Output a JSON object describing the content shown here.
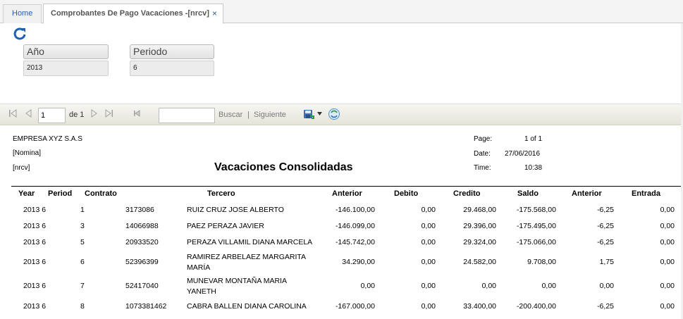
{
  "tabs": {
    "home": "Home",
    "active": "Comprobantes De Pago Vacaciones -[nrcv]",
    "close": "×"
  },
  "params": {
    "anio_label": "Año",
    "anio_value": "2013",
    "periodo_label": "Periodo",
    "periodo_value": "6"
  },
  "toolbar": {
    "page_value": "1",
    "of_text": "de 1",
    "search_placeholder": "",
    "buscar": "Buscar",
    "separator": "|",
    "siguiente": "Siguiente"
  },
  "report": {
    "company": "EMPRESA XYZ S.A.S",
    "line2": "[Nomina]",
    "line3": "[nrcv]",
    "title": "Vacaciones Consolidadas",
    "page_label": "Page:",
    "page_value": "1 of 1",
    "date_label": "Date:",
    "date_value": "27/06/2016",
    "time_label": "Time:",
    "time_value": "10:38"
  },
  "columns": {
    "year": "Year",
    "period": "Period",
    "contrato": "Contrato",
    "tercero": "Tercero",
    "anterior": "Anterior",
    "debito": "Debito",
    "credito": "Credito",
    "saldo": "Saldo",
    "anterior2": "Anterior",
    "entrada": "Entrada"
  },
  "rows": [
    {
      "year_period": "2013 6",
      "contrato": "1",
      "id": "3173086",
      "tercero1": "RUIZ CRUZ JOSE ALBERTO",
      "tercero2": "",
      "anterior": "-146.100,00",
      "debito": "0,00",
      "credito": "29.468,00",
      "saldo": "-175.568,00",
      "anterior2": "-6,25",
      "entrada": "0,00"
    },
    {
      "year_period": "2013 6",
      "contrato": "3",
      "id": "14066988",
      "tercero1": "PAEZ PERAZA JAVIER",
      "tercero2": "",
      "anterior": "-146.099,00",
      "debito": "0,00",
      "credito": "29.396,00",
      "saldo": "-175.495,00",
      "anterior2": "-6,25",
      "entrada": "0,00"
    },
    {
      "year_period": "2013 6",
      "contrato": "5",
      "id": "20933520",
      "tercero1": "PERAZA VILLAMIL DIANA MARCELA",
      "tercero2": "",
      "anterior": "-145.742,00",
      "debito": "0,00",
      "credito": "29.324,00",
      "saldo": "-175.066,00",
      "anterior2": "-6,25",
      "entrada": "0,00"
    },
    {
      "year_period": "2013 6",
      "contrato": "6",
      "id": "52396399",
      "tercero1": "RAMIREZ ARBELAEZ MARGARITA",
      "tercero2": "MARÍA",
      "anterior": "34.290,00",
      "debito": "0,00",
      "credito": "24.582,00",
      "saldo": "9.708,00",
      "anterior2": "1,75",
      "entrada": "0,00"
    },
    {
      "year_period": "2013 6",
      "contrato": "7",
      "id": "52417040",
      "tercero1": "MUNEVAR MONTAÑA MARIA",
      "tercero2": "YANETH",
      "anterior": "0,00",
      "debito": "0,00",
      "credito": "0,00",
      "saldo": "0,00",
      "anterior2": "0,00",
      "entrada": "0,00"
    },
    {
      "year_period": "2013 6",
      "contrato": "8",
      "id": "1073381462",
      "tercero1": "CABRA BALLEN DIANA CAROLINA",
      "tercero2": "",
      "anterior": "-167.000,00",
      "debito": "0,00",
      "credito": "33.400,00",
      "saldo": "-200.400,00",
      "anterior2": "-6,25",
      "entrada": "0,00"
    }
  ]
}
